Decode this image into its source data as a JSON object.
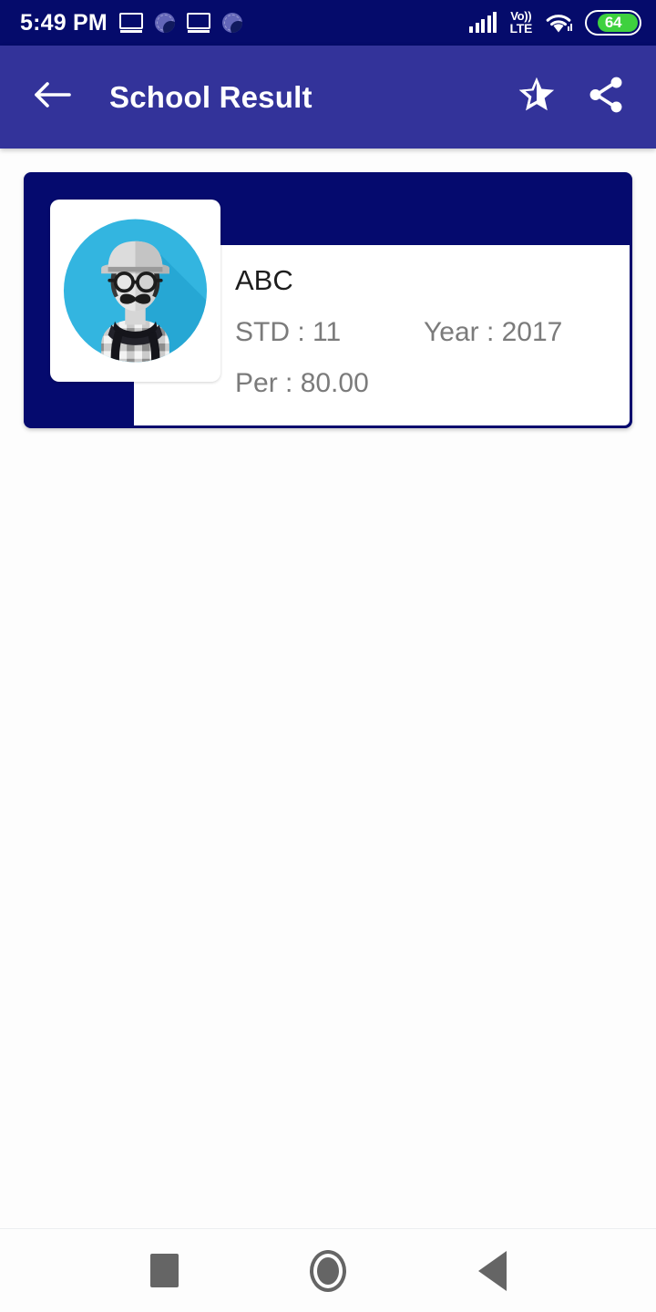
{
  "status_bar": {
    "time": "5:49 PM",
    "background": "#050b6b",
    "left_icons": [
      "cast-icon",
      "notification-badge-icon",
      "cast-icon",
      "notification-badge-icon"
    ],
    "network_label_top": "Vo))",
    "network_label_bottom": "LTE",
    "battery_level": "64",
    "battery_fill_color": "#3ed13e",
    "right_icons": [
      "signal-icon",
      "volte-icon",
      "wifi-icon",
      "battery-icon"
    ]
  },
  "app_bar": {
    "title": "School Result",
    "background": "#33339a",
    "back_icon": "arrow-back-icon",
    "favorite_icon": "star-half-icon",
    "share_icon": "share-icon"
  },
  "result_card": {
    "card_background": "#050a6e",
    "panel_background": "#ffffff",
    "avatar_icon": "hipster-avatar-icon",
    "avatar_circle_color": "#33b5e0",
    "student_name": "ABC",
    "std_label": "STD : 11",
    "year_label": "Year : 2017",
    "percentage_label": "Per : 80.00"
  },
  "nav_bar": {
    "recents_icon": "square-recents-icon",
    "home_icon": "circle-home-icon",
    "back_icon": "triangle-back-icon",
    "icon_color": "#656565"
  }
}
